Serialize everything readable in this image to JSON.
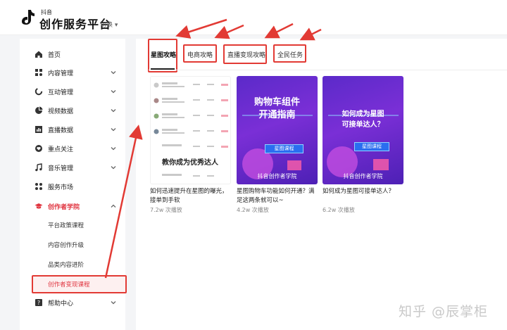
{
  "header": {
    "brand_small": "抖音",
    "brand_title": "创作服务平台",
    "switch_label": "切换"
  },
  "sidebar": {
    "items": [
      {
        "label": "首页",
        "icon": "home-icon"
      },
      {
        "label": "内容管理",
        "icon": "grid-icon"
      },
      {
        "label": "互动管理",
        "icon": "interaction-icon"
      },
      {
        "label": "视频数据",
        "icon": "pie-chart-icon"
      },
      {
        "label": "直播数据",
        "icon": "bar-chart-icon"
      },
      {
        "label": "重点关注",
        "icon": "heart-icon"
      },
      {
        "label": "音乐管理",
        "icon": "music-note-icon"
      },
      {
        "label": "服务市场",
        "icon": "apps-icon"
      },
      {
        "label": "创作者学院",
        "icon": "graduation-cap-icon"
      },
      {
        "label": "帮助中心",
        "icon": "help-icon"
      }
    ],
    "sub_items": [
      "平台政策课程",
      "内容创作升级",
      "品类内容进阶",
      "创作者变现课程"
    ]
  },
  "tabs": [
    "星图攻略",
    "电商攻略",
    "直播变现攻略",
    "全民任务"
  ],
  "cards": [
    {
      "title": "如何迅速提升在星图的曝光，接单到手软",
      "views": "7.2w 次播放",
      "overlay": "教你成为优秀达人"
    },
    {
      "title": "星图购物车功能如何开通？满足这两条就可以~",
      "views": "4.2w 次播放",
      "headline1": "购物车组件",
      "headline2": "开通指南",
      "badge": "星图课程",
      "footer": "抖音创作者学院"
    },
    {
      "title": "如何成为星图可接单达人？",
      "views": "6.2w 次播放",
      "headline1": "如何成为星图",
      "headline2": "可接单达人？",
      "badge": "星图课程",
      "footer": "抖音创作者学院"
    }
  ],
  "watermark": "知乎 @辰掌柜",
  "colors": {
    "accent_red": "#e23a34",
    "active_red": "#e0343f",
    "purple": "#6a2bd0"
  }
}
